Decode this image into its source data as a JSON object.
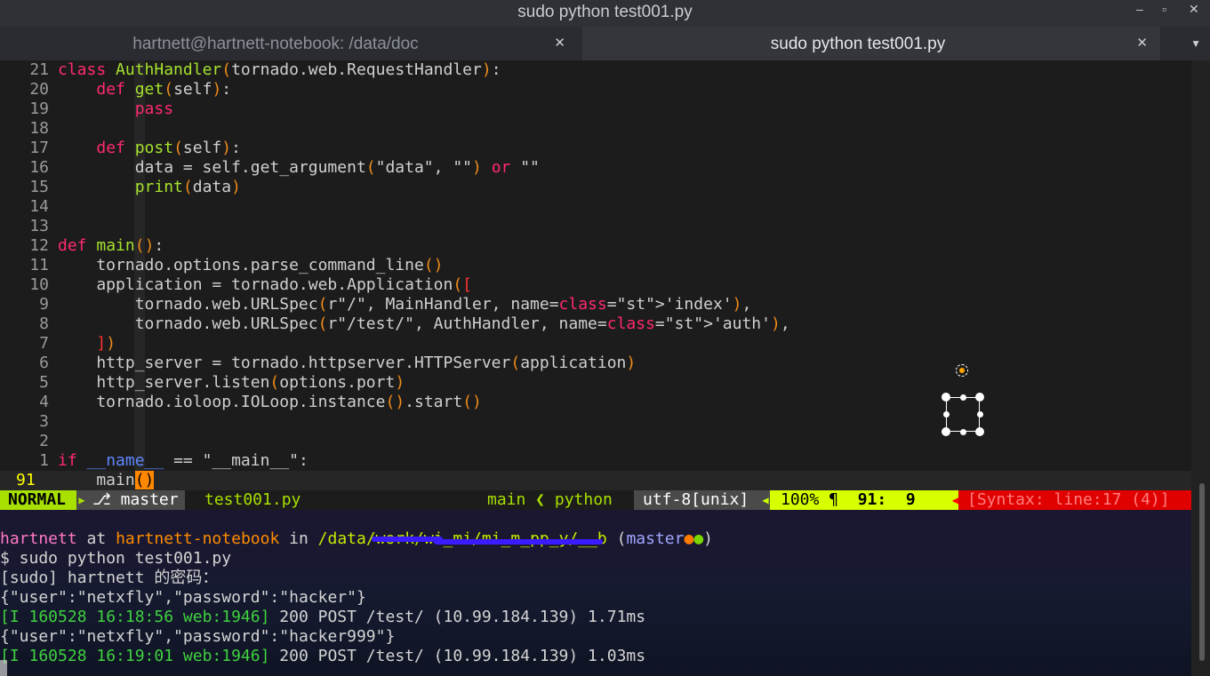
{
  "window": {
    "title": "sudo python test001.py",
    "controls": {
      "minimize": "–",
      "maximize": "▫",
      "close": "✕"
    }
  },
  "tabs": [
    {
      "label": "hartnett@hartnett-notebook: /data/doc",
      "active": false,
      "close": "✕"
    },
    {
      "label": "sudo python test001.py",
      "active": true,
      "close": "✕"
    }
  ],
  "tab_menu_icon": "▼",
  "editor": {
    "relative_numbers": [
      "21",
      "20",
      "19",
      "18",
      "17",
      "16",
      "15",
      "14",
      "13",
      "12",
      "11",
      "10",
      "9",
      "8",
      "7",
      "6",
      "5",
      "4",
      "3",
      "2",
      "1"
    ],
    "current_line_number": "91",
    "lines": [
      "class AuthHandler(tornado.web.RequestHandler):",
      "    def get(self):",
      "        pass",
      "",
      "    def post(self):",
      "        data = self.get_argument(\"data\", \"\") or \"\"",
      "        print(data)",
      "",
      "",
      "def main():",
      "    tornado.options.parse_command_line()",
      "    application = tornado.web.Application([",
      "        tornado.web.URLSpec(r\"/\", MainHandler, name='index'),",
      "        tornado.web.URLSpec(r\"/test/\", AuthHandler, name='auth'),",
      "    ])",
      "    http_server = tornado.httpserver.HTTPServer(application)",
      "    http_server.listen(options.port)",
      "    tornado.ioloop.IOLoop.instance().start()",
      "",
      "",
      "if __name__ == \"__main__\":"
    ],
    "current_line": "    main()"
  },
  "statusline": {
    "mode": "NORMAL",
    "branch": "⎇ master",
    "file": "test001.py",
    "function": "main ❮ python",
    "encoding": "utf-8[unix]",
    "percent": "100% ¶",
    "position": "91:  9",
    "syntax": "[Syntax: line:17 (4)]"
  },
  "terminal": {
    "prompt": {
      "user": "hartnett",
      "at": " at ",
      "host": "hartnett-notebook",
      "in": " in ",
      "path": "/data/work/wi_mi/mi_m_pp_y/__b",
      "branch_open": " (",
      "branch": "master",
      "dots": [
        "●",
        "●"
      ],
      "branch_close": ")"
    },
    "command": "$ sudo python test001.py",
    "sudo_prompt": "[sudo] hartnett 的密码：",
    "output": [
      {
        "text": "{\"user\":\"netxfly\",\"password\":\"hacker\"}"
      },
      {
        "log": "[I 160528 16:18:56 web:1946]",
        "text": " 200 POST /test/ (10.99.184.139) 1.71ms"
      },
      {
        "text": "{\"user\":\"netxfly\",\"password\":\"hacker999\"}"
      },
      {
        "log": "[I 160528 16:19:01 web:1946]",
        "text": " 200 POST /test/ (10.99.184.139) 1.03ms"
      }
    ]
  },
  "colors": {
    "keyword": "#ff2a6d",
    "function": "#a6e22e",
    "paren": "#f08c1a",
    "mode_bg": "#a8e000",
    "syntax_bg": "#e00000",
    "redaction": "#3b1bff"
  }
}
